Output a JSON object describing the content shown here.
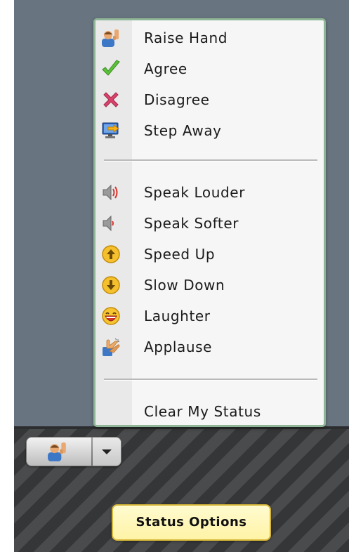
{
  "menu": {
    "group1": [
      {
        "label": "Raise Hand",
        "icon": "raise-hand-icon"
      },
      {
        "label": "Agree",
        "icon": "checkmark-icon"
      },
      {
        "label": "Disagree",
        "icon": "x-icon"
      },
      {
        "label": "Step Away",
        "icon": "step-away-icon"
      }
    ],
    "group2": [
      {
        "label": "Speak Louder",
        "icon": "speaker-loud-icon"
      },
      {
        "label": "Speak Softer",
        "icon": "speaker-soft-icon"
      },
      {
        "label": "Speed Up",
        "icon": "speed-up-icon"
      },
      {
        "label": "Slow Down",
        "icon": "slow-down-icon"
      },
      {
        "label": "Laughter",
        "icon": "laughter-icon"
      },
      {
        "label": "Applause",
        "icon": "applause-icon"
      }
    ],
    "clear_label": "Clear My Status"
  },
  "status_button": {
    "icon": "raise-hand-icon",
    "dropdown_icon": "chevron-down-icon"
  },
  "tooltip": {
    "text": "Status Options"
  },
  "colors": {
    "menu_border": "#8fb696",
    "app_background": "#687581",
    "tooltip_background": "#fff3a6"
  }
}
